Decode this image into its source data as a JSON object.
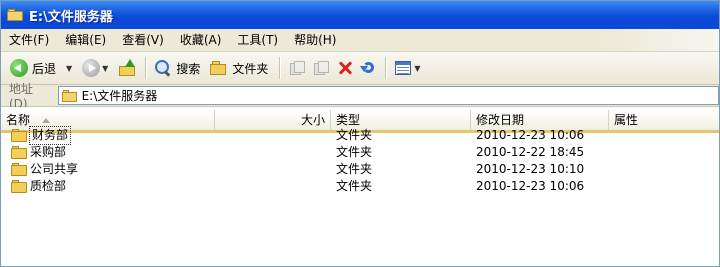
{
  "window": {
    "title": "E:\\文件服务器"
  },
  "menu": [
    "文件(F)",
    "编辑(E)",
    "查看(V)",
    "收藏(A)",
    "工具(T)",
    "帮助(H)"
  ],
  "toolbar": {
    "back_label": "后退",
    "search_label": "搜索",
    "folders_label": "文件夹"
  },
  "address": {
    "label": "地址(D)",
    "path": "E:\\文件服务器"
  },
  "columns": {
    "name": "名称",
    "size": "大小",
    "type": "类型",
    "modified": "修改日期",
    "attributes": "属性"
  },
  "files": [
    {
      "name": "财务部",
      "type": "文件夹",
      "modified": "2010-12-23 10:06"
    },
    {
      "name": "采购部",
      "type": "文件夹",
      "modified": "2010-12-22 18:45"
    },
    {
      "name": "公司共享",
      "type": "文件夹",
      "modified": "2010-12-23 10:10"
    },
    {
      "name": "质检部",
      "type": "文件夹",
      "modified": "2010-12-23 10:06"
    }
  ],
  "colors": {
    "titlebar": "#0a47d8",
    "chrome": "#ece9d8",
    "sorted_header_accent": "#e6c66a"
  }
}
